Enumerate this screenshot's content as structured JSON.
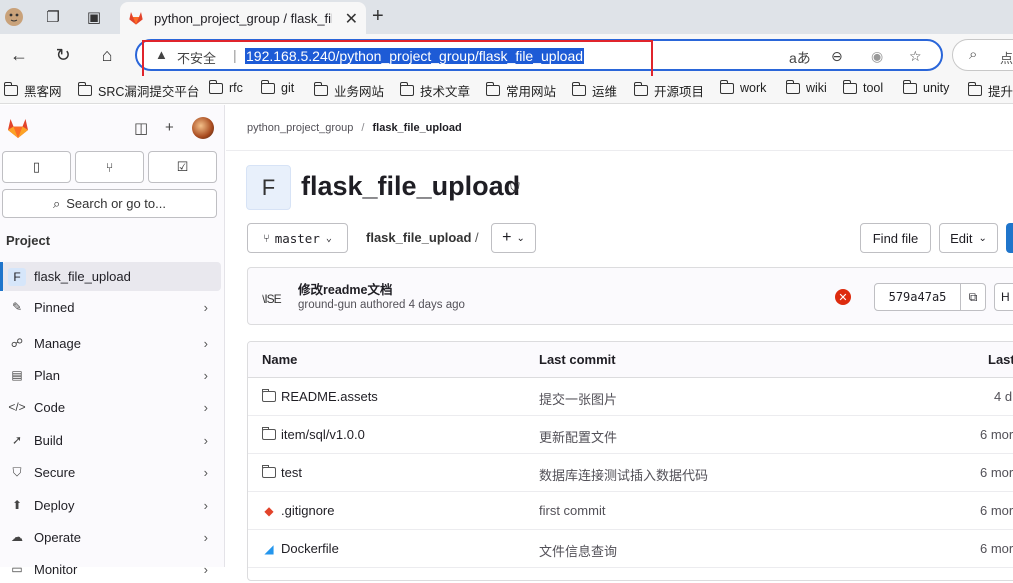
{
  "browser": {
    "tab_title": "python_project_group / flask_file_",
    "security_label": "不安全",
    "url": "192.168.5.240/python_project_group/flask_file_upload",
    "search_hint": "点",
    "bookmarks": [
      "黑客网",
      "SRC漏洞提交平台",
      "rfc",
      "git",
      "业务网站",
      "技术文章",
      "常用网站",
      "运维",
      "开源项目",
      "work",
      "wiki",
      "tool",
      "unity",
      "提升"
    ]
  },
  "sidebar": {
    "search_label": "Search or go to...",
    "section_label": "Project",
    "project_badge": "F",
    "project_name": "flask_file_upload",
    "items": [
      {
        "label": "Pinned",
        "icon": "pin-icon"
      },
      {
        "label": "Manage",
        "icon": "users-icon"
      },
      {
        "label": "Plan",
        "icon": "calendar-icon"
      },
      {
        "label": "Code",
        "icon": "code-icon"
      },
      {
        "label": "Build",
        "icon": "rocket-icon"
      },
      {
        "label": "Secure",
        "icon": "shield-icon"
      },
      {
        "label": "Deploy",
        "icon": "deploy-icon"
      },
      {
        "label": "Operate",
        "icon": "cloud-icon"
      },
      {
        "label": "Monitor",
        "icon": "monitor-icon"
      }
    ]
  },
  "main": {
    "breadcrumb": {
      "group": "python_project_group",
      "separator": "/",
      "project": "flask_file_upload"
    },
    "project_avatar": "F",
    "project_title": "flask_file_upload",
    "branch": "master",
    "path_root": "flask_file_upload",
    "path_slash": "/",
    "find_file_label": "Find file",
    "edit_label": "Edit",
    "commit": {
      "title": "修改readme文档",
      "avatar_alt": "\\ISE",
      "meta": "ground-gun authored 4 days ago",
      "sha": "579a47a5",
      "history_label": "H"
    },
    "table": {
      "headers": {
        "name": "Name",
        "last_commit": "Last commit",
        "last_update": "Last"
      },
      "rows": [
        {
          "name": "README.assets",
          "type": "folder",
          "message": "提交一张图片",
          "date": "4 d"
        },
        {
          "name": "item/sql/v1.0.0",
          "type": "folder",
          "message": "更新配置文件",
          "date": "6 mor"
        },
        {
          "name": "test",
          "type": "folder",
          "message": "数据库连接测试插入数据代码",
          "date": "6 mor"
        },
        {
          "name": ".gitignore",
          "type": "git",
          "message": "first commit",
          "date": "6 mor"
        },
        {
          "name": "Dockerfile",
          "type": "docker",
          "message": "文件信息查询",
          "date": "6 mor"
        }
      ]
    }
  },
  "colors": {
    "accent": "#1f75cb",
    "url_highlight": "#1d5bd6",
    "annotation_box": "#e0242c",
    "pipeline_failed": "#dd2b0e",
    "gitlab_orange": "#e2432a"
  }
}
